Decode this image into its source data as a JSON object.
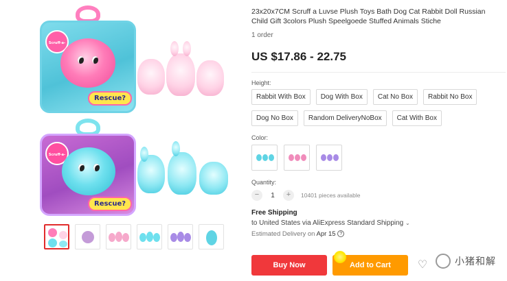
{
  "product": {
    "title": "23x20x7CM Scruff a Luvse Plush Toys Bath Dog Cat Rabbit Doll Russian Child Gift 3colors Plush Speelgoede Stuffed Animals Stiche",
    "orders": "1 order",
    "price": "US $17.86 - 22.75"
  },
  "options": {
    "height_label": "Height:",
    "height_values": [
      "Rabbit With Box",
      "Dog With Box",
      "Cat No Box",
      "Rabbit No Box",
      "Dog No Box",
      "Random DeliveryNoBox",
      "Cat With Box"
    ],
    "color_label": "Color:",
    "colors": [
      {
        "name": "teal-plush",
        "hex": "#5fd4e4"
      },
      {
        "name": "pink-plush",
        "hex": "#f08cbb"
      },
      {
        "name": "purple-plush",
        "hex": "#a88be6"
      }
    ]
  },
  "quantity": {
    "label": "Quantity:",
    "minus": "−",
    "value": "1",
    "plus": "+",
    "available": "10401 pieces available"
  },
  "shipping": {
    "title": "Free Shipping",
    "line": "to United States via AliExpress Standard Shipping",
    "chevron": "⌄",
    "delivery_prefix": "Estimated Delivery on",
    "delivery_date": "Apr 15",
    "help": "?"
  },
  "actions": {
    "buy_now": "Buy Now",
    "add_to_cart": "Add to Cart",
    "wishlist": "♡"
  },
  "gallery": {
    "box_badge_text": "Rescue?",
    "logo_text": "Scruff-a-Luvs",
    "thumbnail_count": 6
  },
  "watermark": {
    "text": "小猪和解"
  },
  "colors": {
    "buy": "#f0383b",
    "cart": "#ff9a00",
    "active_thumb_border": "#e12b2b"
  }
}
